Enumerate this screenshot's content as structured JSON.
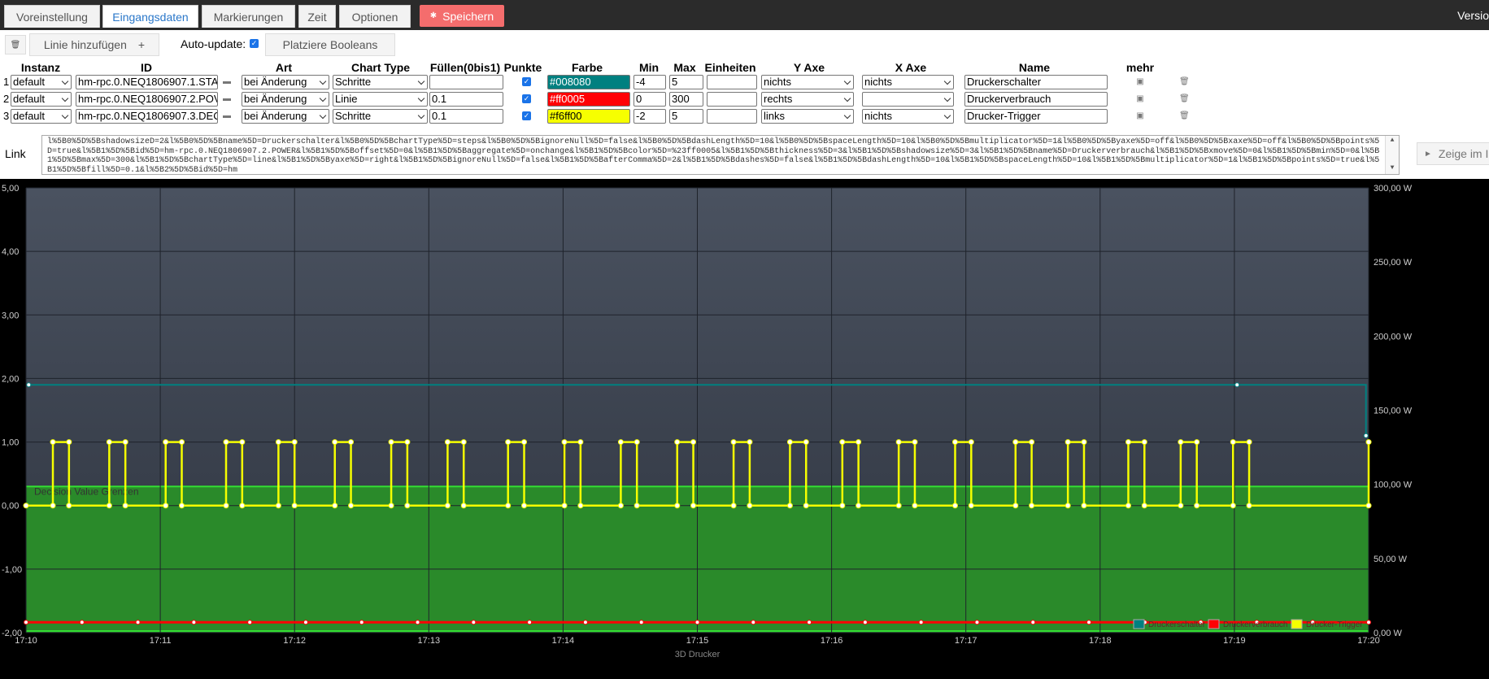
{
  "tabs": [
    {
      "label": "Voreinstellung",
      "active": false
    },
    {
      "label": "Eingangsdaten",
      "active": true
    },
    {
      "label": "Markierungen",
      "active": false
    },
    {
      "label": "Zeit",
      "active": false
    },
    {
      "label": "Optionen",
      "active": false
    }
  ],
  "save_label": "Speichern",
  "version_label": "Versio",
  "toolbar": {
    "add_line_label": "Linie hinzufügen",
    "add_line_plus": "+",
    "auto_update_label": "Auto-update:",
    "auto_update_checked": true,
    "place_booleans_label": "Platziere Booleans"
  },
  "table": {
    "headers": [
      "Instanz",
      "ID",
      "Art",
      "Chart Type",
      "Füllen(0bis1)",
      "Punkte",
      "Farbe",
      "Min",
      "Max",
      "Einheiten",
      "Y Axe",
      "X Axe",
      "Name",
      "mehr"
    ],
    "rows": [
      {
        "num": "1",
        "instanz": "default",
        "id": "hm-rpc.0.NEQ1806907.1.STA",
        "art": "bei Änderung",
        "chart_type": "Schritte",
        "fill": "",
        "points": true,
        "color": "#008080",
        "min": "-4",
        "max": "5",
        "units": "",
        "y_axe": "nichts",
        "x_axe": "nichts",
        "name": "Druckerschalter"
      },
      {
        "num": "2",
        "instanz": "default",
        "id": "hm-rpc.0.NEQ1806907.2.POV",
        "art": "bei Änderung",
        "chart_type": "Linie",
        "fill": "0.1",
        "points": true,
        "color": "#ff0005",
        "min": "0",
        "max": "300",
        "units": "",
        "y_axe": "rechts",
        "x_axe": "",
        "name": "Druckerverbrauch"
      },
      {
        "num": "3",
        "instanz": "default",
        "id": "hm-rpc.0.NEQ1806907.3.DEC",
        "art": "bei Änderung",
        "chart_type": "Schritte",
        "fill": "0.1",
        "points": true,
        "color": "#f6ff00",
        "min": "-2",
        "max": "5",
        "units": "",
        "y_axe": "links",
        "x_axe": "nichts",
        "name": "Drucker-Trigger"
      }
    ]
  },
  "link": {
    "label": "Link",
    "text": "l%5B0%5D%5BshadowsizeD=2&l%5B0%5D%5Bname%5D=Druckerschalter&l%5B0%5D%5BchartType%5D=steps&l%5B0%5D%5BignoreNull%5D=false&l%5B0%5D%5BdashLength%5D=10&l%5B0%5D%5BspaceLength%5D=10&l%5B0%5D%5Bmultiplicator%5D=1&l%5B0%5D%5Byaxe%5D=off&l%5B0%5D%5Bxaxe%5D=off&l%5B0%5D%5Bpoints%5D=true&l%5B1%5D%5Bid%5D=hm-rpc.0.NEQ1806907.2.POWER&l%5B1%5D%5Boffset%5D=0&l%5B1%5D%5Baggregate%5D=onchange&l%5B1%5D%5Bcolor%5D=%23ff0005&l%5B1%5D%5Bthickness%5D=3&l%5B1%5D%5Bshadowsize%5D=3&l%5B1%5D%5Bname%5D=Druckerverbrauch&l%5B1%5D%5Bxmove%5D=0&l%5B1%5D%5Bmin%5D=0&l%5B1%5D%5Bmax%5D=300&l%5B1%5D%5BchartType%5D=line&l%5B1%5D%5Byaxe%5D=right&l%5B1%5D%5BignoreNull%5D=false&l%5B1%5D%5BafterComma%5D=2&l%5B1%5D%5Bdashes%5D=false&l%5B1%5D%5BdashLength%5D=10&l%5B1%5D%5BspaceLength%5D=10&l%5B1%5D%5Bmultiplicator%5D=1&l%5B1%5D%5Bpoints%5D=true&l%5B1%5D%5Bfill%5D=0.1&l%5B2%5D%5Bid%5D=hm"
  },
  "show_button_label": "Zeige im I",
  "chart_data": {
    "type": "line",
    "xlabel": "3D Drucker",
    "x_ticks": [
      "17:10",
      "17:11",
      "17:12",
      "17:13",
      "17:14",
      "17:15",
      "17:16",
      "17:17",
      "17:18",
      "17:19",
      "17:20"
    ],
    "y_left_ticks": [
      "5,00",
      "4,00",
      "3,00",
      "2,00",
      "1,00",
      "0,00",
      "-1,00",
      "-2,00"
    ],
    "y_right_ticks": [
      "300,00 W",
      "250,00 W",
      "200,00 W",
      "150,00 W",
      "100,00 W",
      "50,00 W",
      "0,00 W"
    ],
    "ylim_left": [
      -2,
      5
    ],
    "ylim_right": [
      0,
      300
    ],
    "band_label": "Decision Value Grenzen",
    "band_range": [
      -2,
      0.3
    ],
    "colors": {
      "background": "#4a5260",
      "band": "#2a8a2a",
      "band_border": "#33dd33",
      "series1": "#008080",
      "series2": "#ff0005",
      "series3": "#f6ff00"
    },
    "series": [
      {
        "name": "Druckerschalter",
        "axis": "left",
        "color": "#008080",
        "x": [
          17.167,
          17.317,
          17.333,
          17.333
        ],
        "y": [
          1.9,
          1.9,
          1.9,
          1.1
        ]
      },
      {
        "name": "Druckerverbrauch",
        "axis": "right",
        "color": "#ff0005",
        "x": [
          17.167,
          17.333
        ],
        "y": [
          7,
          7
        ]
      },
      {
        "name": "Drucker-Trigger",
        "axis": "left",
        "color": "#f6ff00",
        "pulses": [
          [
            17.17,
            17.172
          ],
          [
            17.177,
            17.179
          ],
          [
            17.184,
            17.186
          ],
          [
            17.1915,
            17.1935
          ],
          [
            17.198,
            17.2
          ],
          [
            17.205,
            17.207
          ],
          [
            17.212,
            17.214
          ],
          [
            17.219,
            17.221
          ],
          [
            17.2265,
            17.2285
          ],
          [
            17.2335,
            17.2355
          ],
          [
            17.2405,
            17.2425
          ],
          [
            17.2475,
            17.2495
          ],
          [
            17.2545,
            17.2565
          ],
          [
            17.2615,
            17.2635
          ],
          [
            17.268,
            17.27
          ],
          [
            17.275,
            17.277
          ],
          [
            17.282,
            17.284
          ],
          [
            17.2895,
            17.2915
          ],
          [
            17.296,
            17.298
          ],
          [
            17.3035,
            17.3055
          ],
          [
            17.31,
            17.312
          ],
          [
            17.3165,
            17.3185
          ]
        ],
        "low": 0,
        "high": 1
      }
    ],
    "legend": [
      "Druckerschalter",
      "Druckerverbrauch",
      "Drucker-Trigger"
    ]
  }
}
